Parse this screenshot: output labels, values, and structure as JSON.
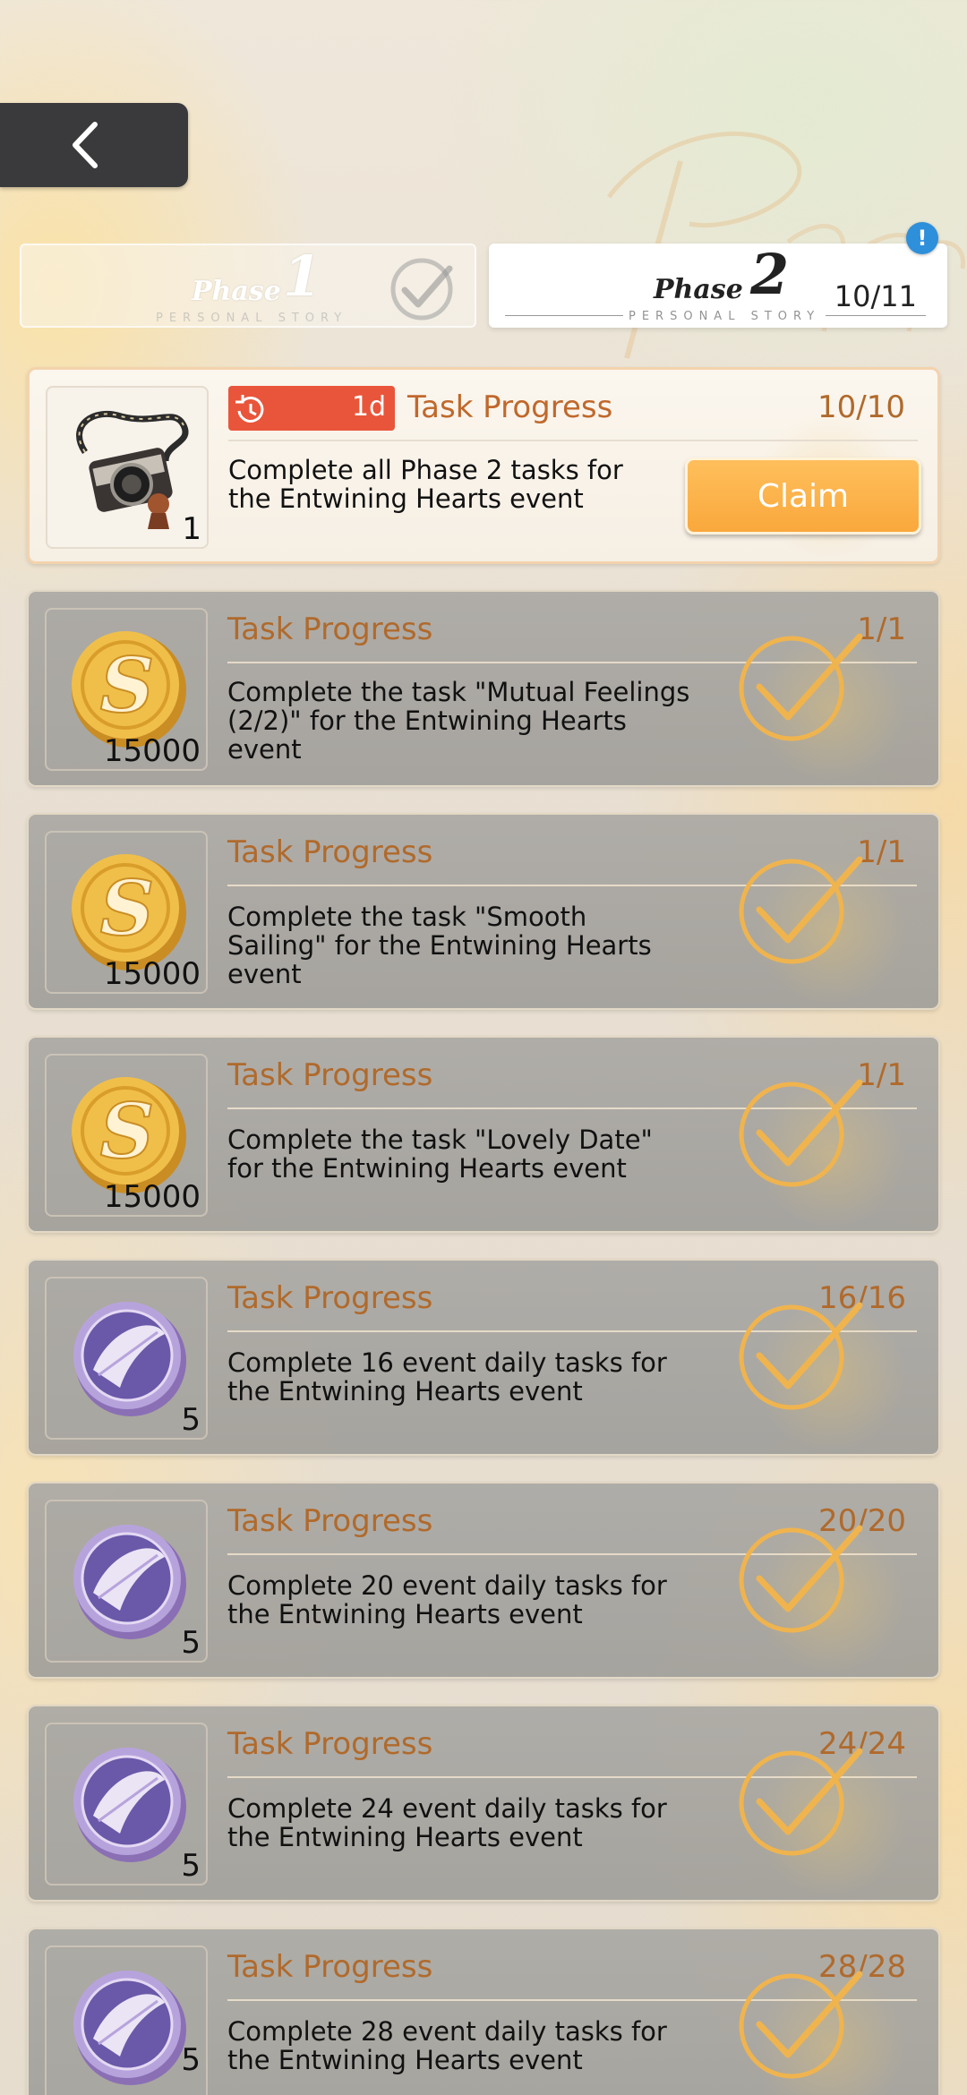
{
  "header": {
    "back_icon": "chevron-left-icon"
  },
  "phases": [
    {
      "word": "Phase",
      "number": "1",
      "subtitle": "PERSONAL STORY",
      "completed": true
    },
    {
      "word": "Phase",
      "number": "2",
      "subtitle": "PERSONAL STORY",
      "progress": "10/11",
      "alert": "!"
    }
  ],
  "tasks": [
    {
      "title": "Task Progress",
      "progress": "10/10",
      "description": "Complete all Phase 2 tasks for the Entwining Hearts event",
      "reward_type": "camera-icon",
      "reward_count": "1",
      "timer": "1d",
      "claim_label": "Claim",
      "state": "claimable"
    },
    {
      "title": "Task Progress",
      "progress": "1/1",
      "description": "Complete the task \"Mutual Feelings (2/2)\" for the Entwining Hearts event",
      "reward_type": "coin-icon",
      "reward_count": "15000",
      "state": "done"
    },
    {
      "title": "Task Progress",
      "progress": "1/1",
      "description": "Complete the task \"Smooth Sailing\" for the Entwining Hearts event",
      "reward_type": "coin-icon",
      "reward_count": "15000",
      "state": "done"
    },
    {
      "title": "Task Progress",
      "progress": "1/1",
      "description": "Complete the task \"Lovely Date\" for the Entwining Hearts event",
      "reward_type": "coin-icon",
      "reward_count": "15000",
      "state": "done"
    },
    {
      "title": "Task Progress",
      "progress": "16/16",
      "description": "Complete 16 event daily tasks for the Entwining Hearts event",
      "reward_type": "feather-token-icon",
      "reward_count": "5",
      "state": "done"
    },
    {
      "title": "Task Progress",
      "progress": "20/20",
      "description": "Complete 20 event daily tasks for the Entwining Hearts event",
      "reward_type": "feather-token-icon",
      "reward_count": "5",
      "state": "done"
    },
    {
      "title": "Task Progress",
      "progress": "24/24",
      "description": "Complete 24 event daily tasks for the Entwining Hearts event",
      "reward_type": "feather-token-icon",
      "reward_count": "5",
      "state": "done"
    },
    {
      "title": "Task Progress",
      "progress": "28/28",
      "description": "Complete 28 event daily tasks for the Entwining Hearts event",
      "reward_type": "feather-token-icon",
      "reward_count": "5",
      "state": "done"
    }
  ]
}
